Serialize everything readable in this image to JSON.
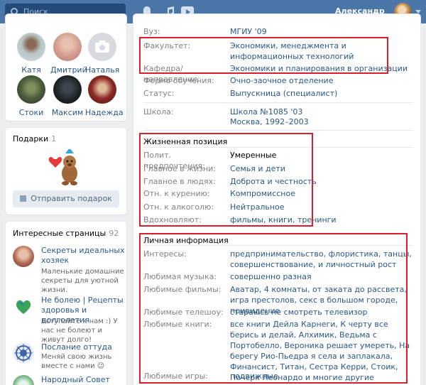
{
  "header": {
    "search_placeholder": "Поиск",
    "user_name": "Александр",
    "icons": [
      "bell-icon",
      "music-icon",
      "video-icon"
    ],
    "brand_color": "#4a76a8"
  },
  "friends": {
    "items": [
      {
        "name": "Катя",
        "color": "#b9c7c9"
      },
      {
        "name": "Дмитрий",
        "color": "#d9a597"
      },
      {
        "name": "Наталья",
        "color": "#d7dbe0"
      },
      {
        "name": "Стоки",
        "color": "#4a5d3c"
      },
      {
        "name": "Максим",
        "color": "#1c2024"
      },
      {
        "name": "Надежда",
        "color": "#8c2a24"
      }
    ]
  },
  "gifts": {
    "title": "Подарки",
    "count": "1",
    "send_label": "Отправить подарок"
  },
  "pages": {
    "title": "Интересные страницы",
    "count": "92",
    "items": [
      {
        "title": "Секреты идеальных хозяек",
        "desc": "Маленькие домашние секреты для уютной жизни."
      },
      {
        "title": "Не болею | Рецепты здоровья и долголетия",
        "desc": "Вступайте к нам :) У нас не болеют и живут долго!"
      },
      {
        "title": "Послание оттуда",
        "desc": "Меняй свою жизнь вместе с нами 😉"
      },
      {
        "title": "Народный Совет района",
        "desc": ""
      }
    ]
  },
  "education": {
    "rows": [
      {
        "k": "Вуз:",
        "v": "МГИУ '09"
      },
      {
        "k": "Факультет:",
        "v": "Экономики, менеджмента и информационных технологий"
      },
      {
        "k": "Кафедра/направление:",
        "v": "Экономики и планирования в организации"
      },
      {
        "k": "Форма обучения:",
        "v": "Очно-заочное отделение"
      },
      {
        "k": "Статус:",
        "v": "Выпускница (специалист)"
      }
    ],
    "school_key": "Школа:",
    "school_name": "Школа №1085 '03",
    "school_years": "Москва, 1992–2003"
  },
  "life_position": {
    "title": "Жизненная позиция",
    "rows": [
      {
        "k": "Полит. предпочтения:",
        "v": "Умеренные"
      },
      {
        "k": "Главное в жизни:",
        "v": "Семья и дети"
      },
      {
        "k": "Главное в людях:",
        "v": "Доброта и честность"
      },
      {
        "k": "Отн. к курению:",
        "v": "Компромиссное"
      },
      {
        "k": "Отн. к алкоголю:",
        "v": "Нейтральное"
      },
      {
        "k": "Вдохновляют:",
        "v": "фильмы, книги, тренинги"
      }
    ]
  },
  "personal": {
    "title": "Личная информация",
    "rows": [
      {
        "k": "Интересы:",
        "v": "предпринимательство, флористика, танцы, совершенствование, и личностный рост"
      },
      {
        "k": "Любимая музыка:",
        "v": "совершенно разная"
      },
      {
        "k": "Любимые фильмы:",
        "v": "Аватар, 4 комнаты, от заката до рассвета, игра престолов, секс в большом городе, привидение"
      },
      {
        "k": "Любимые телешоу:",
        "v": "стараюсь не смотреть телевизор"
      },
      {
        "k": "Любимые книги:",
        "v": "все книги Дейла Карнеги, К черту все берись и делай, Алхимик, Ведьма с Портобелло, Вероника решает умереть, На берегу Рио-Пьедра я села и заплакала, Финансист, Титан, Сестра Керри, Стоик, Почерк Леонардо и многие другие"
      },
      {
        "k": "Любимые игры:",
        "v": "подвижные"
      }
    ]
  },
  "highlight_color": "#d6202d"
}
